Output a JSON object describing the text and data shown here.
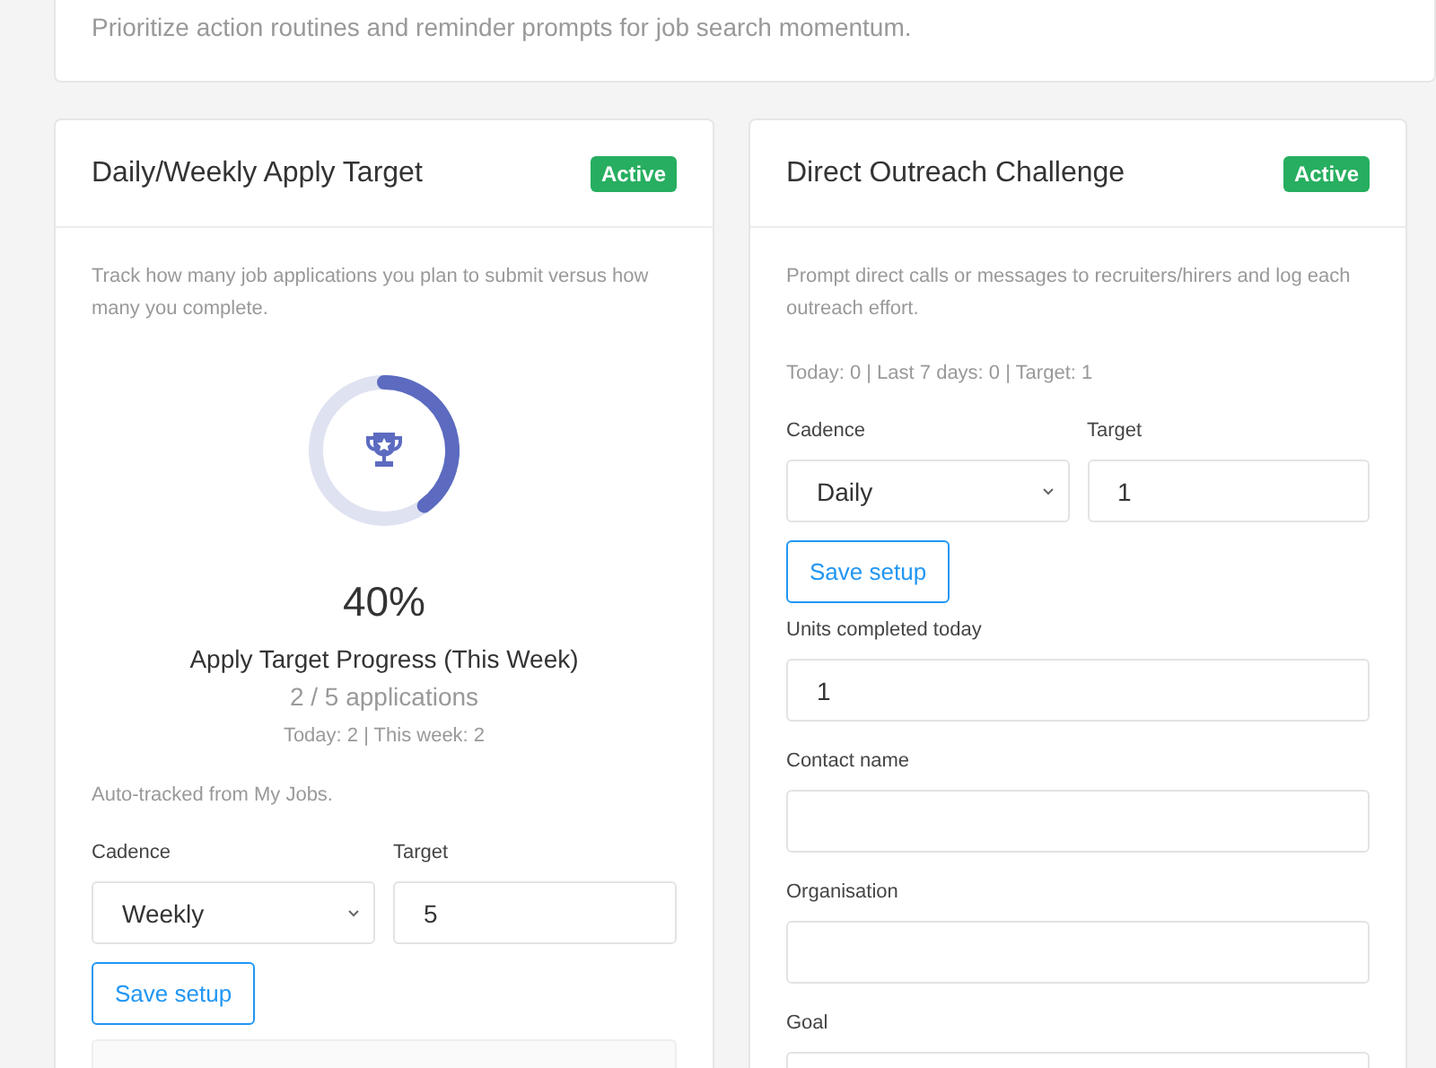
{
  "intro": {
    "text": "Prioritize action routines and reminder prompts for job search momentum."
  },
  "cards": [
    {
      "title": "Daily/Weekly Apply Target",
      "status": "Active",
      "description": "Track how many job applications you plan to submit versus how many you complete.",
      "blocks": [
        {
          "kind": "progress",
          "level": 0.4,
          "percent": "40%",
          "heading": "Apply Target Progress (This Week)",
          "count": "2 / 5 applications",
          "stats": "Today: 2 | This week: 2"
        },
        {
          "kind": "note",
          "text": "Auto-tracked from My Jobs."
        },
        {
          "kind": "setup",
          "cadence": {
            "label": "Cadence",
            "value": "Weekly"
          },
          "target": {
            "label": "Target",
            "value": "5"
          },
          "button": "Save setup"
        },
        {
          "kind": "panel"
        }
      ]
    },
    {
      "title": "Direct Outreach Challenge",
      "status": "Active",
      "description": "Prompt direct calls or messages to recruiters/hirers and log each outreach effort.",
      "blocks": [
        {
          "kind": "note",
          "text": "Today: 0 | Last 7 days: 0 | Target: 1"
        },
        {
          "kind": "setup",
          "cadence": {
            "label": "Cadence",
            "value": "Daily"
          },
          "target": {
            "label": "Target",
            "value": "1"
          },
          "button": "Save setup"
        },
        {
          "kind": "field",
          "label": "Units completed today",
          "value": "1"
        },
        {
          "kind": "field",
          "label": "Contact name"
        },
        {
          "kind": "field",
          "label": "Organisation"
        },
        {
          "kind": "field",
          "label": "Goal"
        }
      ]
    }
  ]
}
